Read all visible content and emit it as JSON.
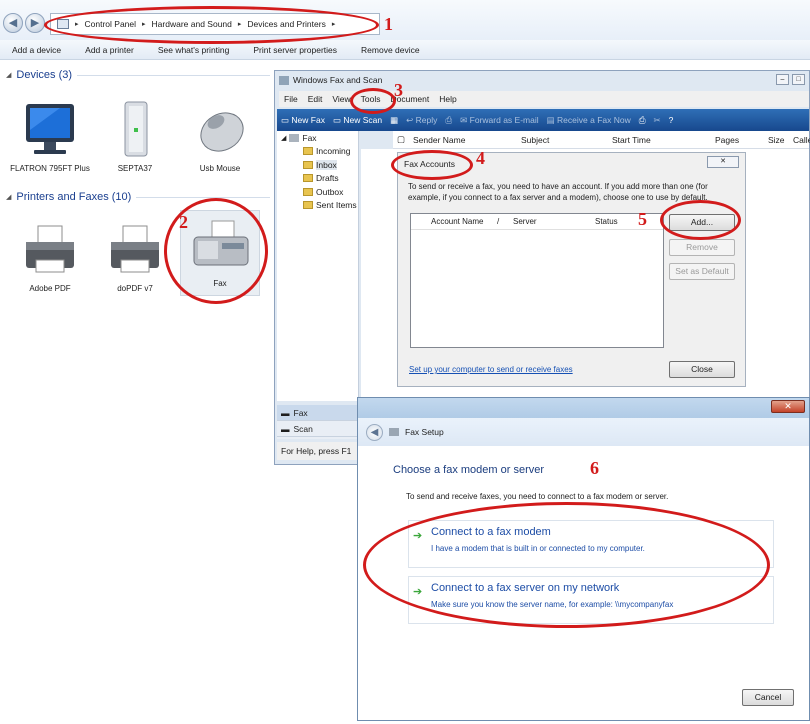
{
  "breadcrumb": {
    "items": [
      "Control Panel",
      "Hardware and Sound",
      "Devices and Printers"
    ]
  },
  "commandbar": {
    "items": [
      "Add a device",
      "Add a printer",
      "See what's printing",
      "Print server properties",
      "Remove device"
    ]
  },
  "devices": {
    "heading": "Devices (3)",
    "items": [
      {
        "label": "FLATRON 795FT Plus",
        "icon": "monitor-icon"
      },
      {
        "label": "SEPTA37",
        "icon": "computer-tower-icon"
      },
      {
        "label": "Usb Mouse",
        "icon": "mouse-icon"
      }
    ]
  },
  "printers": {
    "heading": "Printers and Faxes (10)",
    "items": [
      {
        "label": "Adobe PDF",
        "icon": "printer-icon"
      },
      {
        "label": "doPDF v7",
        "icon": "printer-icon"
      },
      {
        "label": "Fax",
        "icon": "fax-machine-icon"
      }
    ]
  },
  "faxwin": {
    "title": "Windows Fax and Scan",
    "menu": [
      "File",
      "Edit",
      "View",
      "Tools",
      "Document",
      "Help"
    ],
    "toolbar": {
      "new_fax": "New Fax",
      "new_scan": "New Scan",
      "reply": "Reply",
      "forward": "Forward as E-mail",
      "receive": "Receive a Fax Now"
    },
    "tree": {
      "root": "Fax",
      "folders": [
        "Incoming",
        "Inbox",
        "Drafts",
        "Outbox",
        "Sent Items"
      ]
    },
    "columns": [
      "Sender Name",
      "Subject",
      "Start Time",
      "Pages",
      "Size",
      "Caller"
    ],
    "nav": [
      "Fax",
      "Scan"
    ],
    "status": "For Help, press F1"
  },
  "accounts": {
    "title": "Fax Accounts",
    "description": "To send or receive a fax, you need to have an account. If you add more than one (for example, if you connect to a fax server and a modem), choose one to use by default.",
    "columns": [
      "Account Name",
      "Server",
      "Status"
    ],
    "add": "Add...",
    "remove": "Remove",
    "set_default": "Set as Default",
    "setup_link": "Set up your computer to send or receive faxes",
    "close": "Close"
  },
  "setup": {
    "title": "Fax Setup",
    "heading": "Choose a fax modem or server",
    "intro": "To send and receive faxes, you need to connect to a fax modem or server.",
    "options": [
      {
        "title": "Connect to a fax modem",
        "desc": "I have a modem that is built in or connected to my computer."
      },
      {
        "title": "Connect to a fax server on my network",
        "desc": "Make sure you know the server name, for example: \\\\mycompanyfax"
      }
    ],
    "cancel": "Cancel"
  },
  "annotations": [
    "1",
    "2",
    "3",
    "4",
    "5",
    "6"
  ],
  "colors": {
    "annotation": "#d21b1b",
    "link": "#1550b4",
    "toolbar": "#1f5aa0"
  }
}
